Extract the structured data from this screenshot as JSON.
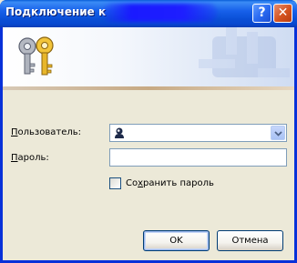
{
  "window": {
    "title": "Подключение к",
    "help_button": "?",
    "close_button": "✕"
  },
  "banner": {
    "icon": "keys-icon",
    "watermark": "keys-watermark-icon"
  },
  "form": {
    "user_label_prefix": "",
    "user_label_accel": "П",
    "user_label_rest": "ользователь:",
    "user_value": "",
    "user_icon": "user-icon",
    "password_label_accel": "П",
    "password_label_rest": "ароль:",
    "password_value": "",
    "save_label_prefix": "Со",
    "save_label_accel": "х",
    "save_label_rest": "ранить пароль",
    "save_checked": false
  },
  "buttons": {
    "ok": "OK",
    "cancel": "Отмена"
  },
  "colors": {
    "titlebar": "#0a4fd6",
    "dialog_bg": "#ece9d8",
    "field_border": "#7f9db9"
  }
}
